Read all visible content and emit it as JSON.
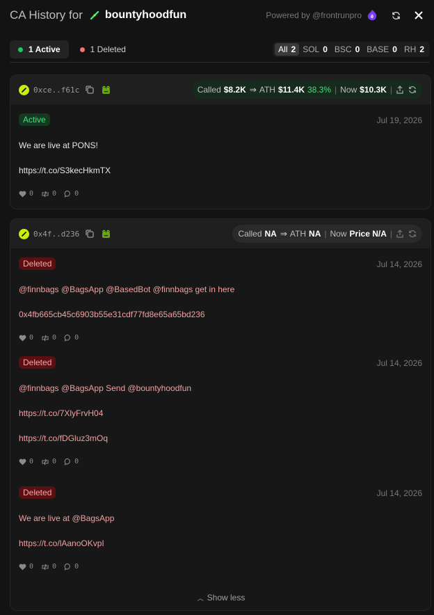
{
  "header": {
    "title": "CA History for",
    "token_name": "bountyhoodfun",
    "powered_by": "Powered by @frontrunpro"
  },
  "status_tabs": [
    {
      "label": "1 Active"
    },
    {
      "label": "1 Deleted"
    }
  ],
  "chains": [
    {
      "label": "All",
      "count": "2"
    },
    {
      "label": "SOL",
      "count": "0"
    },
    {
      "label": "BSC",
      "count": "0"
    },
    {
      "label": "BASE",
      "count": "0"
    },
    {
      "label": "RH",
      "count": "2"
    }
  ],
  "cards": [
    {
      "address": "0xce..f61c",
      "perf": {
        "called_label": "Called",
        "called": "$8.2K",
        "ath_label": "ATH",
        "ath": "$11.4K",
        "ath_pct": "38.3%",
        "sep": "|",
        "now_label": "Now",
        "now": "$10.3K"
      },
      "entries": [
        {
          "status": "Active",
          "date": "Jul 19, 2026",
          "lines": [
            "We are live at PONS!",
            "https://t.co/S3kecHkmTX"
          ],
          "likes": "0",
          "retweets": "0",
          "replies": "0"
        }
      ]
    },
    {
      "address": "0x4f..d236",
      "perf": {
        "called_label": "Called",
        "called": "NA",
        "ath_label": "ATH",
        "ath": "NA",
        "sep": "|",
        "now_label": "Now",
        "now": "Price N/A"
      },
      "entries": [
        {
          "status": "Deleted",
          "date": "Jul 14, 2026",
          "lines": [
            "@finnbags @BagsApp @BasedBot @finnbags  get in here",
            "0x4fb665cb45c6903b55e31cdf77fd8e65a65bd236"
          ],
          "likes": "0",
          "retweets": "0",
          "replies": "0"
        },
        {
          "status": "Deleted",
          "date": "Jul 14, 2026",
          "lines": [
            "@finnbags @BagsApp Send @bountyhoodfun",
            "https://t.co/7XlyFrvH04",
            "https://t.co/fDGluz3mOq"
          ],
          "likes": "0",
          "retweets": "0",
          "replies": "0"
        },
        {
          "status": "Deleted",
          "date": "Jul 14, 2026",
          "lines": [
            "We are live at @BagsApp",
            "https://t.co/lAanoOKvpI"
          ],
          "likes": "0",
          "retweets": "0",
          "replies": "0"
        }
      ],
      "show_less": "Show less"
    }
  ],
  "colors": {
    "background": "#131313",
    "active_green": "#22c55e",
    "deleted_red": "#f87171",
    "brand_purple": "#7c3aed",
    "coin_lime": "#c7f00b"
  }
}
